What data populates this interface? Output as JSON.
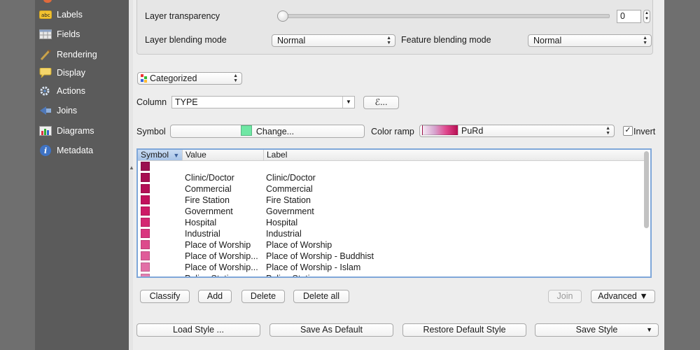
{
  "sidebar": {
    "items": [
      {
        "label": "Labels",
        "icon": "labels-icon"
      },
      {
        "label": "Fields",
        "icon": "fields-icon"
      },
      {
        "label": "Rendering",
        "icon": "rendering-icon"
      },
      {
        "label": "Display",
        "icon": "display-icon"
      },
      {
        "label": "Actions",
        "icon": "actions-icon"
      },
      {
        "label": "Joins",
        "icon": "joins-icon"
      },
      {
        "label": "Diagrams",
        "icon": "diagrams-icon"
      },
      {
        "label": "Metadata",
        "icon": "metadata-icon"
      }
    ]
  },
  "layer": {
    "transparency_label": "Layer transparency",
    "transparency_value": "0",
    "transparency_percent": 0,
    "blending_label": "Layer blending mode",
    "blending_value": "Normal",
    "feature_blending_label": "Feature blending mode",
    "feature_blending_value": "Normal"
  },
  "renderer": {
    "type": "Categorized",
    "column_label": "Column",
    "column_value": "TYPE",
    "expression_button": "ℰ...",
    "symbol_label": "Symbol",
    "symbol_button": "Change...",
    "symbol_color": "#6fe7a4",
    "color_ramp_label": "Color ramp",
    "color_ramp_value": "PuRd",
    "invert_label": "Invert",
    "invert_checked": true
  },
  "table": {
    "headers": {
      "symbol": "Symbol",
      "sort_indicator": "▼",
      "value": "Value",
      "label": "Label"
    },
    "rows": [
      {
        "color": "#9b0f4f",
        "value": "",
        "label": ""
      },
      {
        "color": "#a80e52",
        "value": "Clinic/Doctor",
        "label": "Clinic/Doctor"
      },
      {
        "color": "#b40f56",
        "value": "Commercial",
        "label": "Commercial"
      },
      {
        "color": "#c2105c",
        "value": "Fire Station",
        "label": "Fire Station"
      },
      {
        "color": "#cd1a66",
        "value": "Government",
        "label": "Government"
      },
      {
        "color": "#d42772",
        "value": "Hospital",
        "label": "Hospital"
      },
      {
        "color": "#d9367f",
        "value": "Industrial",
        "label": "Industrial"
      },
      {
        "color": "#dd4a8c",
        "value": "Place of Worship",
        "label": "Place of Worship"
      },
      {
        "color": "#e05c99",
        "value": "Place of Worship...",
        "label": "Place of Worship - Buddhist"
      },
      {
        "color": "#e26fa6",
        "value": "Place of Worship...",
        "label": "Place of Worship - Islam"
      },
      {
        "color": "#e480b2",
        "value": "Police Station",
        "label": "Police Station"
      }
    ]
  },
  "buttons": {
    "classify": "Classify",
    "add": "Add",
    "delete": "Delete",
    "delete_all": "Delete all",
    "join": "Join",
    "advanced": "Advanced ▼",
    "load_style": "Load Style ...",
    "save_default": "Save As Default",
    "restore_default": "Restore Default Style",
    "save_style": "Save Style"
  }
}
